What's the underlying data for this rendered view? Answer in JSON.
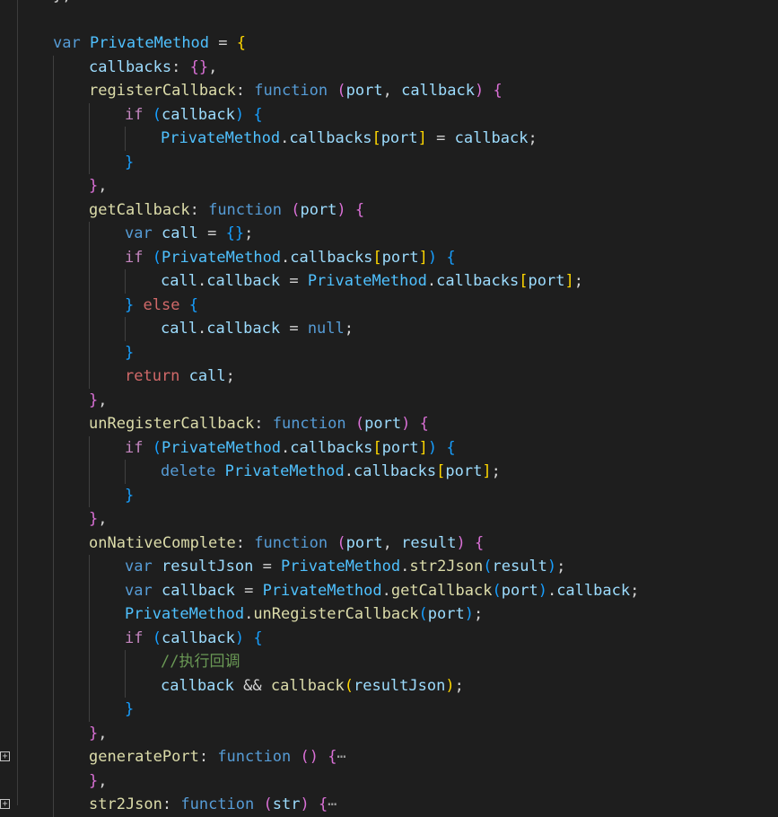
{
  "editor": {
    "language": "javascript",
    "collapsed_placeholder": "⋯",
    "lines": [
      {
        "indent": 0,
        "tokens": [
          [
            "pl",
            "};"
          ]
        ]
      },
      {
        "indent": 0,
        "tokens": []
      },
      {
        "indent": 0,
        "tokens": [
          [
            "kw",
            "var"
          ],
          [
            "pl",
            " "
          ],
          [
            "obj",
            "PrivateMethod"
          ],
          [
            "pl",
            " = "
          ],
          [
            "p1",
            "{"
          ]
        ]
      },
      {
        "indent": 1,
        "tokens": [
          [
            "prop",
            "callbacks"
          ],
          [
            "pl",
            ": "
          ],
          [
            "p2",
            "{}"
          ],
          [
            "pl",
            ","
          ]
        ]
      },
      {
        "indent": 1,
        "tokens": [
          [
            "fn",
            "registerCallback"
          ],
          [
            "pl",
            ": "
          ],
          [
            "kw",
            "function"
          ],
          [
            "pl",
            " "
          ],
          [
            "p2",
            "("
          ],
          [
            "var",
            "port"
          ],
          [
            "pl",
            ", "
          ],
          [
            "var",
            "callback"
          ],
          [
            "p2",
            ")"
          ],
          [
            "pl",
            " "
          ],
          [
            "p2",
            "{"
          ]
        ]
      },
      {
        "indent": 2,
        "tokens": [
          [
            "ctl",
            "if"
          ],
          [
            "pl",
            " "
          ],
          [
            "p3",
            "("
          ],
          [
            "var",
            "callback"
          ],
          [
            "p3",
            ")"
          ],
          [
            "pl",
            " "
          ],
          [
            "p3",
            "{"
          ]
        ]
      },
      {
        "indent": 3,
        "tokens": [
          [
            "obj",
            "PrivateMethod"
          ],
          [
            "pl",
            "."
          ],
          [
            "prop",
            "callbacks"
          ],
          [
            "p1",
            "["
          ],
          [
            "var",
            "port"
          ],
          [
            "p1",
            "]"
          ],
          [
            "pl",
            " = "
          ],
          [
            "var",
            "callback"
          ],
          [
            "pl",
            ";"
          ]
        ]
      },
      {
        "indent": 2,
        "tokens": [
          [
            "p3",
            "}"
          ]
        ]
      },
      {
        "indent": 1,
        "tokens": [
          [
            "p2",
            "}"
          ],
          [
            "pl",
            ","
          ]
        ]
      },
      {
        "indent": 1,
        "tokens": [
          [
            "fn",
            "getCallback"
          ],
          [
            "pl",
            ": "
          ],
          [
            "kw",
            "function"
          ],
          [
            "pl",
            " "
          ],
          [
            "p2",
            "("
          ],
          [
            "var",
            "port"
          ],
          [
            "p2",
            ")"
          ],
          [
            "pl",
            " "
          ],
          [
            "p2",
            "{"
          ]
        ]
      },
      {
        "indent": 2,
        "tokens": [
          [
            "kw",
            "var"
          ],
          [
            "pl",
            " "
          ],
          [
            "var",
            "call"
          ],
          [
            "pl",
            " = "
          ],
          [
            "p3",
            "{}"
          ],
          [
            "pl",
            ";"
          ]
        ]
      },
      {
        "indent": 2,
        "tokens": [
          [
            "ctl",
            "if"
          ],
          [
            "pl",
            " "
          ],
          [
            "p3",
            "("
          ],
          [
            "obj",
            "PrivateMethod"
          ],
          [
            "pl",
            "."
          ],
          [
            "prop",
            "callbacks"
          ],
          [
            "p1",
            "["
          ],
          [
            "var",
            "port"
          ],
          [
            "p1",
            "]"
          ],
          [
            "p3",
            ")"
          ],
          [
            "pl",
            " "
          ],
          [
            "p3",
            "{"
          ]
        ]
      },
      {
        "indent": 3,
        "tokens": [
          [
            "var",
            "call"
          ],
          [
            "pl",
            "."
          ],
          [
            "prop",
            "callback"
          ],
          [
            "pl",
            " = "
          ],
          [
            "obj",
            "PrivateMethod"
          ],
          [
            "pl",
            "."
          ],
          [
            "prop",
            "callbacks"
          ],
          [
            "p1",
            "["
          ],
          [
            "var",
            "port"
          ],
          [
            "p1",
            "]"
          ],
          [
            "pl",
            ";"
          ]
        ]
      },
      {
        "indent": 2,
        "tokens": [
          [
            "p3",
            "}"
          ],
          [
            "pl",
            " "
          ],
          [
            "ctl2",
            "else"
          ],
          [
            "pl",
            " "
          ],
          [
            "p3",
            "{"
          ]
        ]
      },
      {
        "indent": 3,
        "tokens": [
          [
            "var",
            "call"
          ],
          [
            "pl",
            "."
          ],
          [
            "prop",
            "callback"
          ],
          [
            "pl",
            " = "
          ],
          [
            "kw",
            "null"
          ],
          [
            "pl",
            ";"
          ]
        ]
      },
      {
        "indent": 2,
        "tokens": [
          [
            "p3",
            "}"
          ]
        ]
      },
      {
        "indent": 2,
        "tokens": [
          [
            "ctl2",
            "return"
          ],
          [
            "pl",
            " "
          ],
          [
            "var",
            "call"
          ],
          [
            "pl",
            ";"
          ]
        ]
      },
      {
        "indent": 1,
        "tokens": [
          [
            "p2",
            "}"
          ],
          [
            "pl",
            ","
          ]
        ]
      },
      {
        "indent": 1,
        "tokens": [
          [
            "fn",
            "unRegisterCallback"
          ],
          [
            "pl",
            ": "
          ],
          [
            "kw",
            "function"
          ],
          [
            "pl",
            " "
          ],
          [
            "p2",
            "("
          ],
          [
            "var",
            "port"
          ],
          [
            "p2",
            ")"
          ],
          [
            "pl",
            " "
          ],
          [
            "p2",
            "{"
          ]
        ]
      },
      {
        "indent": 2,
        "tokens": [
          [
            "ctl",
            "if"
          ],
          [
            "pl",
            " "
          ],
          [
            "p3",
            "("
          ],
          [
            "obj",
            "PrivateMethod"
          ],
          [
            "pl",
            "."
          ],
          [
            "prop",
            "callbacks"
          ],
          [
            "p1",
            "["
          ],
          [
            "var",
            "port"
          ],
          [
            "p1",
            "]"
          ],
          [
            "p3",
            ")"
          ],
          [
            "pl",
            " "
          ],
          [
            "p3",
            "{"
          ]
        ]
      },
      {
        "indent": 3,
        "tokens": [
          [
            "kw",
            "delete"
          ],
          [
            "pl",
            " "
          ],
          [
            "obj",
            "PrivateMethod"
          ],
          [
            "pl",
            "."
          ],
          [
            "prop",
            "callbacks"
          ],
          [
            "p1",
            "["
          ],
          [
            "var",
            "port"
          ],
          [
            "p1",
            "]"
          ],
          [
            "pl",
            ";"
          ]
        ]
      },
      {
        "indent": 2,
        "tokens": [
          [
            "p3",
            "}"
          ]
        ]
      },
      {
        "indent": 1,
        "tokens": [
          [
            "p2",
            "}"
          ],
          [
            "pl",
            ","
          ]
        ]
      },
      {
        "indent": 1,
        "tokens": [
          [
            "fn",
            "onNativeComplete"
          ],
          [
            "pl",
            ": "
          ],
          [
            "kw",
            "function"
          ],
          [
            "pl",
            " "
          ],
          [
            "p2",
            "("
          ],
          [
            "var",
            "port"
          ],
          [
            "pl",
            ", "
          ],
          [
            "var",
            "result"
          ],
          [
            "p2",
            ")"
          ],
          [
            "pl",
            " "
          ],
          [
            "p2",
            "{"
          ]
        ]
      },
      {
        "indent": 2,
        "tokens": [
          [
            "kw",
            "var"
          ],
          [
            "pl",
            " "
          ],
          [
            "var",
            "resultJson"
          ],
          [
            "pl",
            " = "
          ],
          [
            "obj",
            "PrivateMethod"
          ],
          [
            "pl",
            "."
          ],
          [
            "fn",
            "str2Json"
          ],
          [
            "p3",
            "("
          ],
          [
            "var",
            "result"
          ],
          [
            "p3",
            ")"
          ],
          [
            "pl",
            ";"
          ]
        ]
      },
      {
        "indent": 2,
        "tokens": [
          [
            "kw",
            "var"
          ],
          [
            "pl",
            " "
          ],
          [
            "var",
            "callback"
          ],
          [
            "pl",
            " = "
          ],
          [
            "obj",
            "PrivateMethod"
          ],
          [
            "pl",
            "."
          ],
          [
            "fn",
            "getCallback"
          ],
          [
            "p3",
            "("
          ],
          [
            "var",
            "port"
          ],
          [
            "p3",
            ")"
          ],
          [
            "pl",
            "."
          ],
          [
            "prop",
            "callback"
          ],
          [
            "pl",
            ";"
          ]
        ]
      },
      {
        "indent": 2,
        "tokens": [
          [
            "obj",
            "PrivateMethod"
          ],
          [
            "pl",
            "."
          ],
          [
            "fn",
            "unRegisterCallback"
          ],
          [
            "p3",
            "("
          ],
          [
            "var",
            "port"
          ],
          [
            "p3",
            ")"
          ],
          [
            "pl",
            ";"
          ]
        ]
      },
      {
        "indent": 2,
        "tokens": [
          [
            "ctl",
            "if"
          ],
          [
            "pl",
            " "
          ],
          [
            "p3",
            "("
          ],
          [
            "var",
            "callback"
          ],
          [
            "p3",
            ")"
          ],
          [
            "pl",
            " "
          ],
          [
            "p3",
            "{"
          ]
        ]
      },
      {
        "indent": 3,
        "tokens": [
          [
            "cm",
            "//执行回调"
          ]
        ]
      },
      {
        "indent": 3,
        "tokens": [
          [
            "var",
            "callback"
          ],
          [
            "pl",
            " && "
          ],
          [
            "fn",
            "callback"
          ],
          [
            "p1",
            "("
          ],
          [
            "var",
            "resultJson"
          ],
          [
            "p1",
            ")"
          ],
          [
            "pl",
            ";"
          ]
        ]
      },
      {
        "indent": 2,
        "tokens": [
          [
            "p3",
            "}"
          ]
        ]
      },
      {
        "indent": 1,
        "tokens": [
          [
            "p2",
            "}"
          ],
          [
            "pl",
            ","
          ]
        ]
      },
      {
        "indent": 1,
        "fold": true,
        "tokens": [
          [
            "fn",
            "generatePort"
          ],
          [
            "pl",
            ": "
          ],
          [
            "kw",
            "function"
          ],
          [
            "pl",
            " "
          ],
          [
            "p2",
            "()"
          ],
          [
            "pl",
            " "
          ],
          [
            "p2",
            "{"
          ],
          [
            "ell",
            "⋯"
          ]
        ]
      },
      {
        "indent": 1,
        "tokens": [
          [
            "p2",
            "}"
          ],
          [
            "pl",
            ","
          ]
        ]
      },
      {
        "indent": 1,
        "fold": true,
        "tokens": [
          [
            "fn",
            "str2Json"
          ],
          [
            "pl",
            ": "
          ],
          [
            "kw",
            "function"
          ],
          [
            "pl",
            " "
          ],
          [
            "p2",
            "("
          ],
          [
            "var",
            "str"
          ],
          [
            "p2",
            ")"
          ],
          [
            "pl",
            " "
          ],
          [
            "p2",
            "{"
          ],
          [
            "ell",
            "⋯"
          ]
        ]
      }
    ]
  }
}
